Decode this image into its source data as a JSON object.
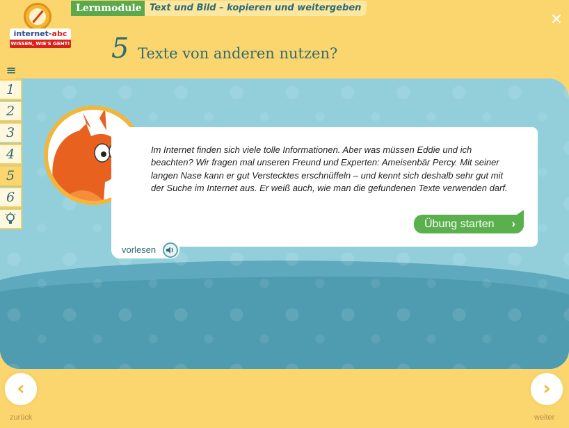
{
  "breadcrumb": {
    "module": "Lernmodule",
    "title": "Text und Bild – kopieren und weitergeben"
  },
  "close_icon": "close-icon",
  "logo": {
    "word_main": "internet-",
    "word_accent": "abc",
    "slogan": "WISSEN, WIE'S GEHT!"
  },
  "chapter": {
    "number": "5",
    "title": "Texte von anderen nutzen?"
  },
  "nav": {
    "menu_icon": "≡",
    "items": [
      "1",
      "2",
      "3",
      "4",
      "5",
      "6"
    ],
    "active_index": 4
  },
  "dialog": {
    "text": "Im Internet finden sich viele tolle Informationen. Aber was müssen Eddie und ich beachten? Wir fragen mal unseren Freund und Experten: Ameisenbär Percy. Mit seiner langen Nase kann er gut Verstecktes erschnüffeln – und kennt sich deshalb sehr gut mit der Suche im Internet aus. Er weiß auch, wie man die gefundenen Texte verwenden darf.",
    "start_label": "Übung starten",
    "read_aloud_label": "vorlesen"
  },
  "footer": {
    "prev_label": "zurück",
    "next_label": "weiter"
  },
  "colors": {
    "accent_green": "#5bb04e",
    "teal_text": "#2f6b72",
    "frame_yellow": "#fbd66e"
  }
}
